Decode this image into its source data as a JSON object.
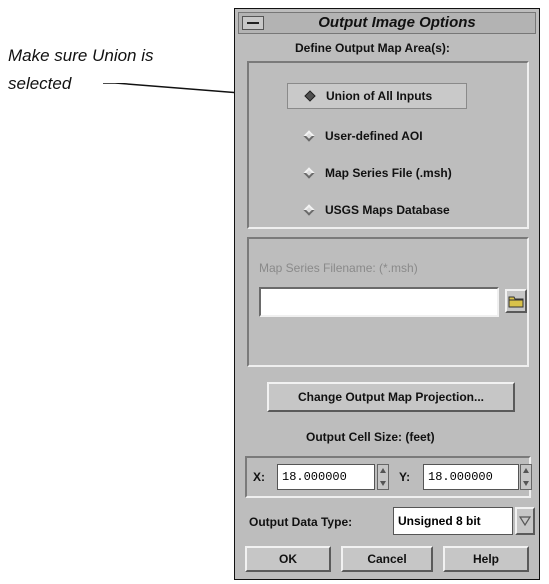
{
  "annotation": {
    "line1": "Make sure Union is",
    "line2": "selected"
  },
  "window": {
    "title": "Output Image Options",
    "section_label": "Define Output Map Area(s):",
    "radios": [
      {
        "label": "Union of All Inputs",
        "selected": true
      },
      {
        "label": "User-defined AOI",
        "selected": false
      },
      {
        "label": "Map Series File (.msh)",
        "selected": false
      },
      {
        "label": "USGS Maps Database",
        "selected": false
      }
    ],
    "map_series_label": "Map Series Filename: (*.msh)",
    "map_series_value": "",
    "projection_button": "Change Output Map Projection...",
    "cell_size_label": "Output Cell Size: (feet)",
    "x_label": "X:",
    "x_value": "18.000000",
    "y_label": "Y:",
    "y_value": "18.000000",
    "data_type_label": "Output Data Type:",
    "data_type_value": "Unsigned 8 bit",
    "ok": "OK",
    "cancel": "Cancel",
    "help": "Help"
  }
}
